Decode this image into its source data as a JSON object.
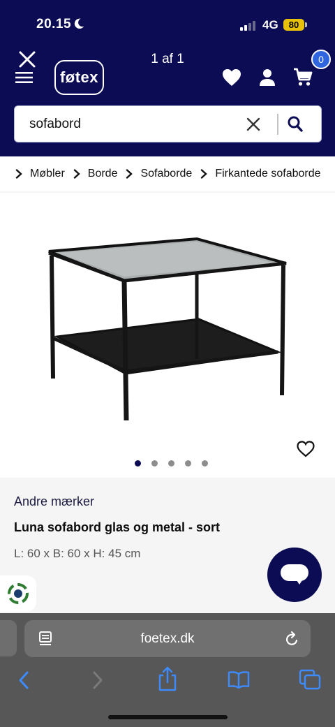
{
  "status_bar": {
    "time": "20.15",
    "network": "4G",
    "battery": "80"
  },
  "header": {
    "logo": "føtex",
    "pager": "1 af 1",
    "cart_count": "0",
    "colors": {
      "header_bg": "#0c0c55",
      "badge": "#2f66e0"
    }
  },
  "search": {
    "value": "sofabord",
    "placeholder": ""
  },
  "breadcrumb": [
    {
      "label": "Møbler"
    },
    {
      "label": "Borde"
    },
    {
      "label": "Sofaborde"
    },
    {
      "label": "Firkantede sofaborde"
    }
  ],
  "gallery": {
    "image_count": 5,
    "active_index": 0
  },
  "product": {
    "brand": "Andre mærker",
    "title": "Luna sofabord glas og metal - sort",
    "dimensions": "L: 60 x B: 60 x H: 45 cm"
  },
  "browser": {
    "url": "foetex.dk"
  },
  "icons": [
    "close-icon",
    "hamburger-icon",
    "heart-icon",
    "user-icon",
    "cart-icon",
    "search-icon",
    "clear-icon",
    "chevron-right-icon",
    "favorite-heart-icon",
    "chat-icon",
    "recycle-icon",
    "page-menu-icon",
    "reload-icon",
    "back-icon",
    "forward-icon",
    "share-icon",
    "bookmarks-icon",
    "tabs-icon"
  ]
}
